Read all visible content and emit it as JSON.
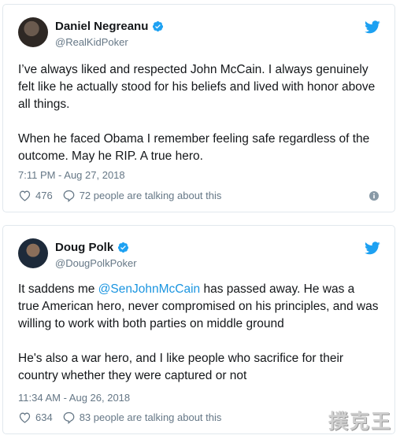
{
  "tweets": [
    {
      "name": "Daniel Negreanu",
      "handle": "@RealKidPoker",
      "paragraphs": [
        "I’ve always liked and respected John McCain. I always genuinely felt like he actually stood for his beliefs and lived with honor above all things.",
        "When he faced Obama I remember feeling safe regardless of the outcome. May he RIP. A true hero."
      ],
      "timestamp": "7:11 PM - Aug 27, 2018",
      "likes": "476",
      "talking": "72 people are talking about this"
    },
    {
      "name": "Doug Polk",
      "handle": "@DougPolkPoker",
      "p1_before": "It saddens me ",
      "p1_mention": "@SenJohnMcCain",
      "p1_after": " has passed away. He was a true American hero, never compromised on his principles, and was willing to work with both parties on middle ground",
      "p2": "He's also a war hero, and I like people who sacrifice for their country whether they were captured or not",
      "timestamp": "11:34 AM - Aug 26, 2018",
      "likes": "634",
      "talking": "83 people are talking about this"
    }
  ],
  "watermark": "撲克王",
  "colors": {
    "twitter_blue": "#1da1f2",
    "mention": "#1b95e0",
    "secondary_text": "#657786",
    "border": "#e1e8ed"
  },
  "icons": [
    "twitter-bird-icon",
    "verified-badge-icon",
    "heart-icon",
    "reply-bubble-icon",
    "info-icon"
  ]
}
